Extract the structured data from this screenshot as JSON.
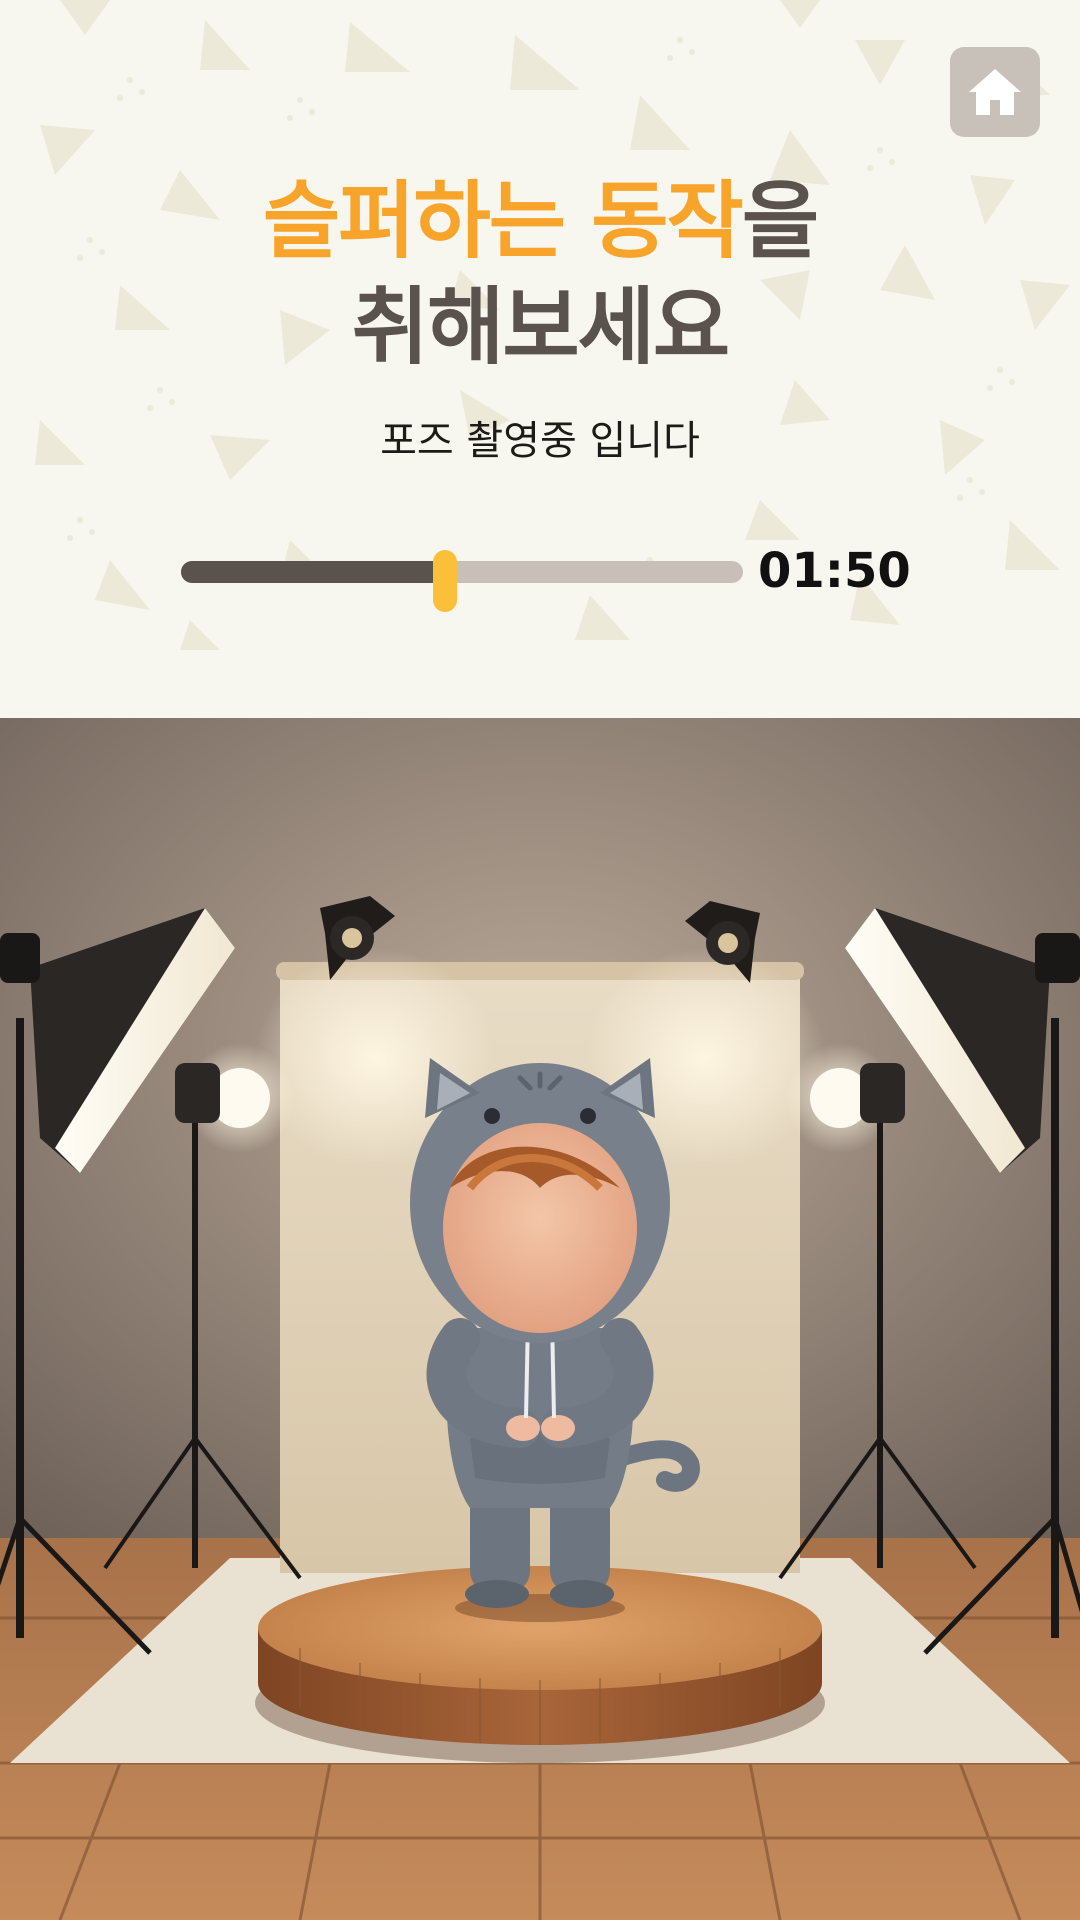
{
  "header": {
    "home_icon": "home-icon",
    "title_highlight": "슬퍼하는 동작",
    "title_suffix": "을",
    "title_line2": "취해보세요",
    "subtitle": "포즈 촬영중 입니다"
  },
  "progress": {
    "value": 0.47,
    "timer": "01:50"
  },
  "colors": {
    "background": "#f8f7ef",
    "accent": "#f8a32a",
    "title_text": "#5a524c",
    "thumb": "#fbbf3a",
    "track": "#c8c0b8",
    "home_button": "#c7c1ba"
  },
  "scene": {
    "subject": "cartoon child in grey cat hoodie on wooden podium",
    "elements": [
      "photo-backdrop",
      "softbox-left",
      "softbox-right",
      "spotlight-left",
      "spotlight-right",
      "ring-light-left",
      "ring-light-right",
      "wooden-podium",
      "wooden-floor"
    ]
  }
}
